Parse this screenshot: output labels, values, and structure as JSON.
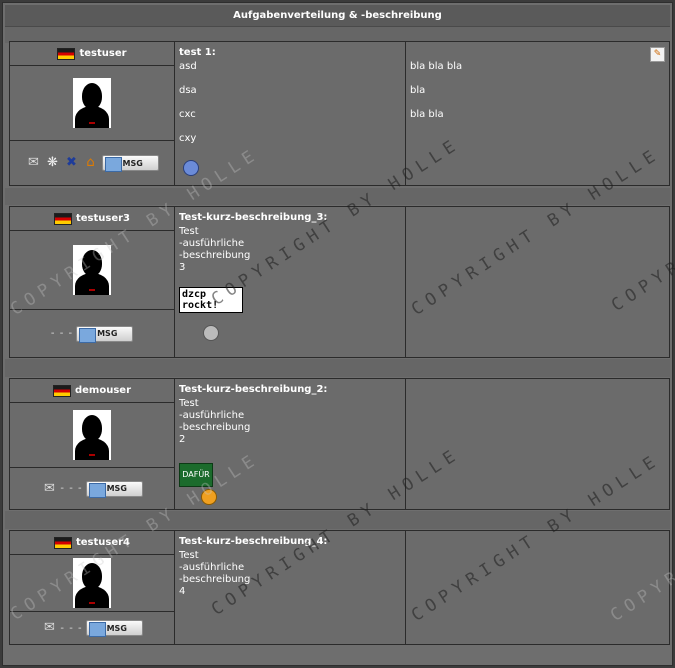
{
  "page_title": "Aufgabenverteilung & -beschreibung",
  "msg_label": "MSG",
  "dashes": "- - -",
  "watermark": "COPYRIGHT BY HOLLE",
  "entries": [
    {
      "user": "testuser",
      "title": "test 1:",
      "lines": [
        "asd",
        "dsa",
        "cxc",
        "cxy"
      ],
      "notes": [
        "bla bla bla",
        "bla",
        "bla bla"
      ],
      "actions": [
        "mail-icon",
        "icq-icon",
        "xfire-icon",
        "home-icon"
      ]
    },
    {
      "user": "testuser3",
      "title": "Test-kurz-beschreibung_3:",
      "lines": [
        "Test",
        "-ausführliche",
        "-beschreibung",
        "3"
      ],
      "sign": "dzcp rockt!"
    },
    {
      "user": "demouser",
      "title": "Test-kurz-beschreibung_2:",
      "lines": [
        "Test",
        "-ausführliche",
        "-beschreibung",
        "2"
      ],
      "sign": "DAFÜR"
    },
    {
      "user": "testuser4",
      "title": "Test-kurz-beschreibung_4:",
      "lines": [
        "Test",
        "-ausführliche",
        "-beschreibung",
        "4"
      ]
    }
  ]
}
